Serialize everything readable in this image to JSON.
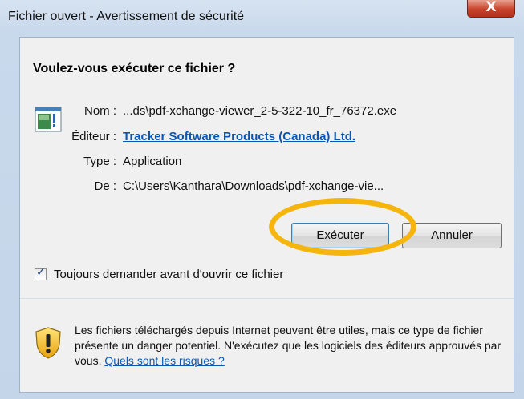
{
  "window": {
    "title": "Fichier ouvert - Avertissement de sécurité",
    "close_label": "X"
  },
  "dialog": {
    "question": "Voulez-vous exécuter ce fichier ?",
    "fields": {
      "name": {
        "label": "Nom :",
        "value": "...ds\\pdf-xchange-viewer_2-5-322-10_fr_76372.exe"
      },
      "publisher": {
        "label": "Éditeur :",
        "value": "Tracker Software Products (Canada) Ltd."
      },
      "type": {
        "label": "Type :",
        "value": "Application"
      },
      "from": {
        "label": "De :",
        "value": "C:\\Users\\Kanthara\\Downloads\\pdf-xchange-vie..."
      }
    },
    "buttons": {
      "run": "Exécuter",
      "cancel": "Annuler"
    },
    "always_ask": {
      "label": "Toujours demander avant d'ouvrir ce fichier",
      "checked": true
    },
    "warning": {
      "text": "Les fichiers téléchargés depuis Internet peuvent être utiles, mais ce type de fichier présente un danger potentiel. N'exécutez que les logiciels des éditeurs approuvés par vous. ",
      "link": "Quels sont les risques ?"
    }
  },
  "colors": {
    "link": "#0a57b3",
    "highlight": "#f5b50c",
    "close_button": "#c8432b"
  },
  "icons": {
    "file": "application-file-icon",
    "warning": "security-shield-icon"
  }
}
